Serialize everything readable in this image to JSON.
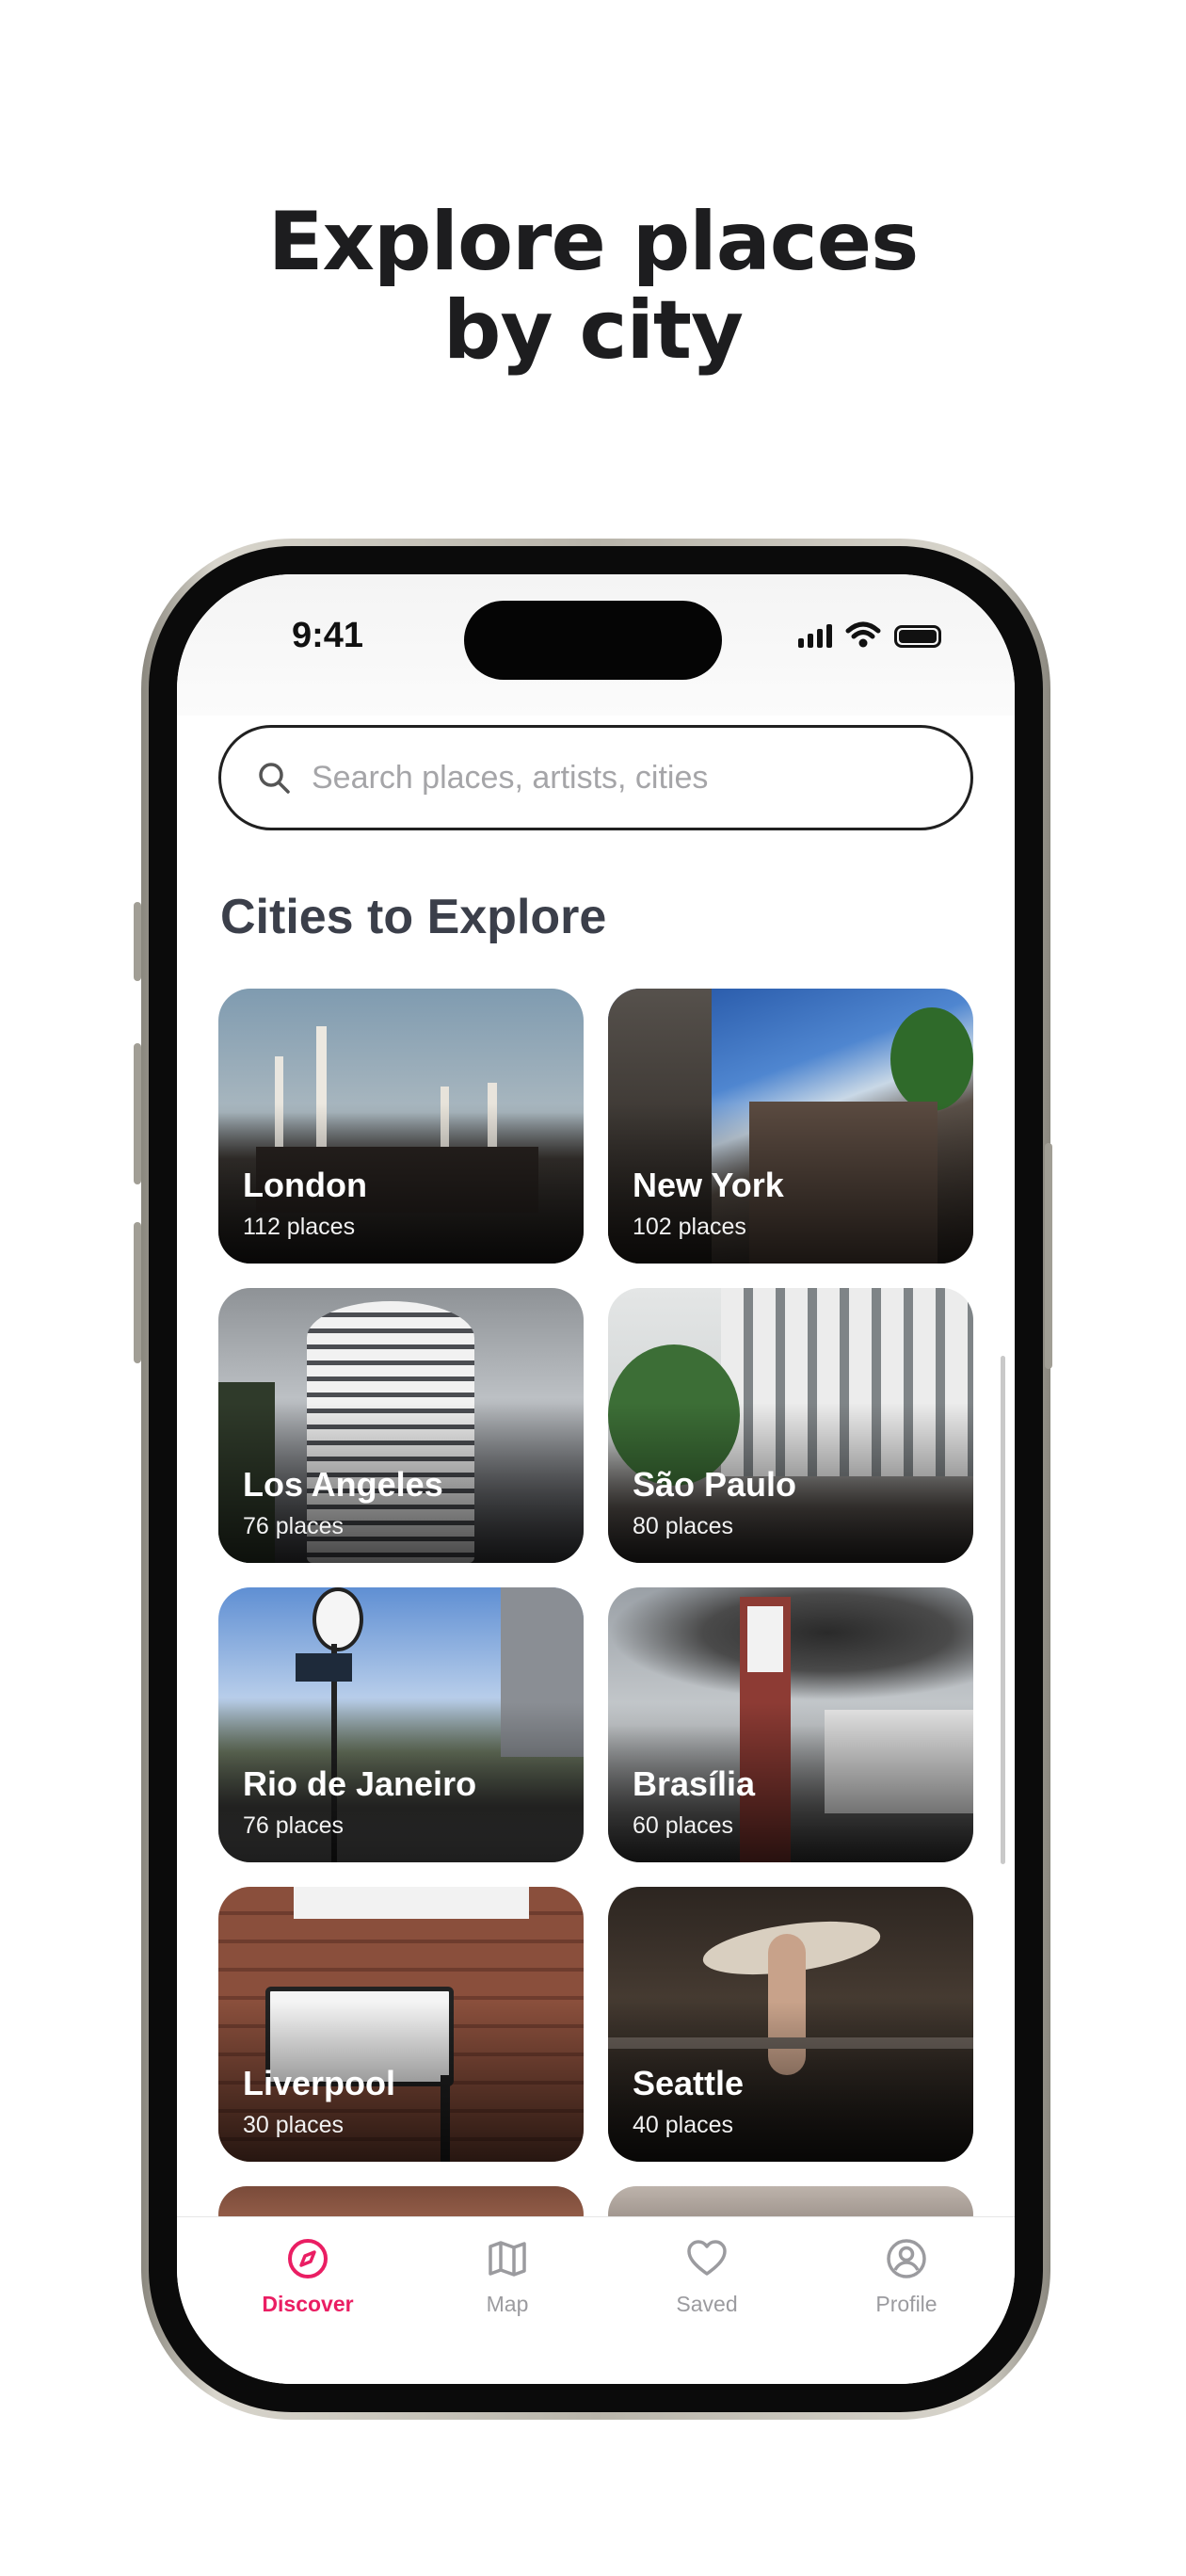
{
  "headline": {
    "line1": "Explore places",
    "line2": "by city"
  },
  "status_bar": {
    "time": "9:41"
  },
  "search": {
    "placeholder": "Search places, artists, cities"
  },
  "section_title": "Cities to Explore",
  "cities": [
    {
      "name": "London",
      "count": "112 places"
    },
    {
      "name": "New York",
      "count": "102 places"
    },
    {
      "name": "Los Angeles",
      "count": "76 places"
    },
    {
      "name": "São Paulo",
      "count": "80 places"
    },
    {
      "name": "Rio de Janeiro",
      "count": "76 places"
    },
    {
      "name": "Brasília",
      "count": "60 places"
    },
    {
      "name": "Liverpool",
      "count": "30 places"
    },
    {
      "name": "Seattle",
      "count": "40 places"
    }
  ],
  "tabs": [
    {
      "label": "Discover",
      "icon": "compass-icon",
      "active": true
    },
    {
      "label": "Map",
      "icon": "map-icon",
      "active": false
    },
    {
      "label": "Saved",
      "icon": "heart-icon",
      "active": false
    },
    {
      "label": "Profile",
      "icon": "profile-icon",
      "active": false
    }
  ],
  "colors": {
    "accent": "#ea1e63",
    "title": "#3b3f4a",
    "inactive_tab": "#9b9b9f"
  }
}
